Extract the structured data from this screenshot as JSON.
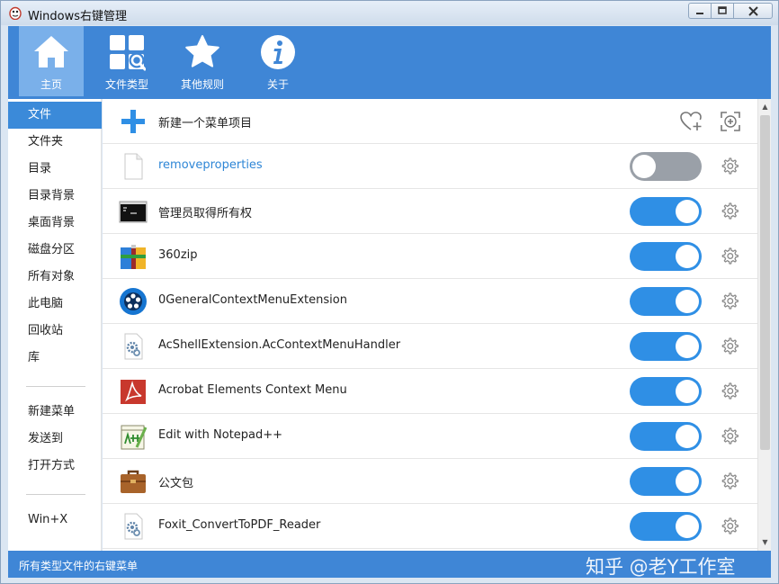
{
  "window": {
    "title": "Windows右键管理"
  },
  "toolbar": {
    "items": [
      {
        "label": "主页",
        "icon": "home-icon"
      },
      {
        "label": "文件类型",
        "icon": "file-types-search-icon"
      },
      {
        "label": "其他规则",
        "icon": "star-icon"
      },
      {
        "label": "关于",
        "icon": "info-icon"
      }
    ],
    "active": "主页"
  },
  "sidebar": {
    "groups": [
      [
        "文件",
        "文件夹",
        "目录",
        "目录背景",
        "桌面背景",
        "磁盘分区",
        "所有对象",
        "此电脑",
        "回收站",
        "库"
      ],
      [
        "新建菜单",
        "发送到",
        "打开方式"
      ],
      [
        "Win+X"
      ]
    ],
    "active": "文件"
  },
  "list": {
    "new_item_label": "新建一个菜单项目",
    "items": [
      {
        "label": "removeproperties",
        "enabled": false,
        "icon": "blank-file-icon"
      },
      {
        "label": "管理员取得所有权",
        "enabled": true,
        "icon": "cmd-console-icon"
      },
      {
        "label": "360zip",
        "enabled": true,
        "icon": "archive-icon"
      },
      {
        "label": "0GeneralContextMenuExtension",
        "enabled": true,
        "icon": "film-reel-icon"
      },
      {
        "label": "AcShellExtension.AcContextMenuHandler",
        "enabled": true,
        "icon": "dll-gear-icon"
      },
      {
        "label": "Acrobat Elements Context Menu",
        "enabled": true,
        "icon": "acrobat-icon"
      },
      {
        "label": "Edit with Notepad++",
        "enabled": true,
        "icon": "notepad-plus-icon"
      },
      {
        "label": "公文包",
        "enabled": true,
        "icon": "briefcase-icon"
      },
      {
        "label": "Foxit_ConvertToPDF_Reader",
        "enabled": true,
        "icon": "dll-gear-icon"
      }
    ]
  },
  "status": {
    "text": "所有类型文件的右键菜单",
    "watermark": "知乎 @老Y工作室"
  },
  "colors": {
    "accent": "#3f86d6",
    "toggle_on": "#2f8fe5",
    "toggle_off": "#9aa0a8"
  }
}
